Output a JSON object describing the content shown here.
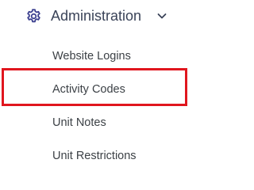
{
  "menu": {
    "section": {
      "title": "Administration",
      "icon": "gear-icon",
      "expand_icon": "chevron-down-icon",
      "color": "#3a4358"
    },
    "items": [
      {
        "label": "Website Logins"
      },
      {
        "label": "Activity Codes",
        "highlighted": true
      },
      {
        "label": "Unit Notes"
      },
      {
        "label": "Unit Restrictions"
      }
    ],
    "highlight_color": "#e0161e"
  }
}
